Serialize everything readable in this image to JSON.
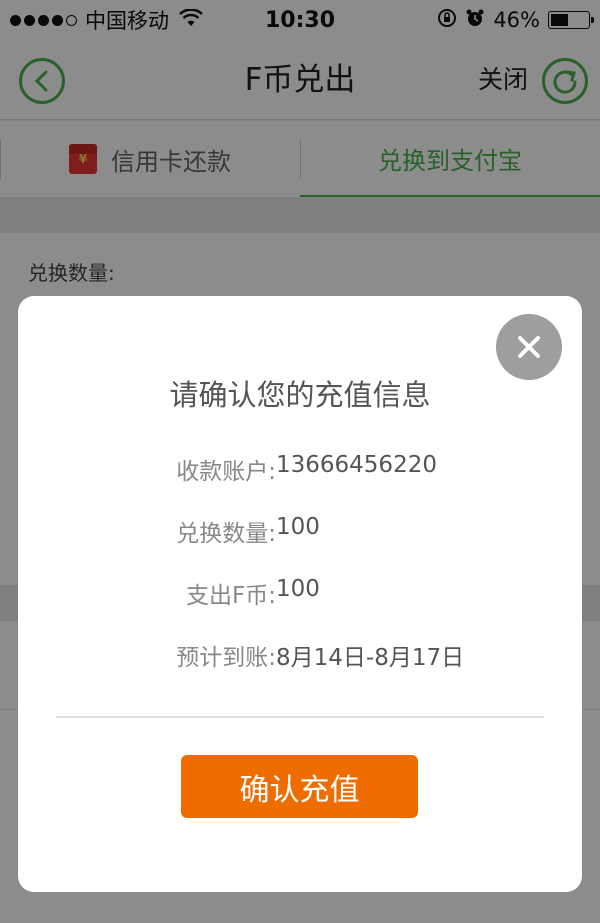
{
  "status_bar": {
    "carrier": "中国移动",
    "time": "10:30",
    "battery": "46%",
    "battery_level": 0.46
  },
  "nav": {
    "title": "F币兑出",
    "close_label": "关闭"
  },
  "tabs": [
    {
      "label": "信用卡还款",
      "icon": "red-packet-icon",
      "active": false
    },
    {
      "label": "兑换到支付宝",
      "active": true
    }
  ],
  "form": {
    "quantity_label": "兑换数量:"
  },
  "dialog": {
    "title": "请确认您的充值信息",
    "rows": [
      {
        "label": "收款账户:",
        "value": "13666456220"
      },
      {
        "label": "兑换数量:",
        "value": "100"
      },
      {
        "label": "支出F币:",
        "value": "100"
      },
      {
        "label": "预计到账:",
        "value": "8月14日-8月17日"
      }
    ],
    "confirm_label": "确认充值"
  },
  "colors": {
    "accent_green": "#4caf50",
    "confirm_orange": "#ef6c00",
    "close_gray": "#9e9e9e"
  }
}
